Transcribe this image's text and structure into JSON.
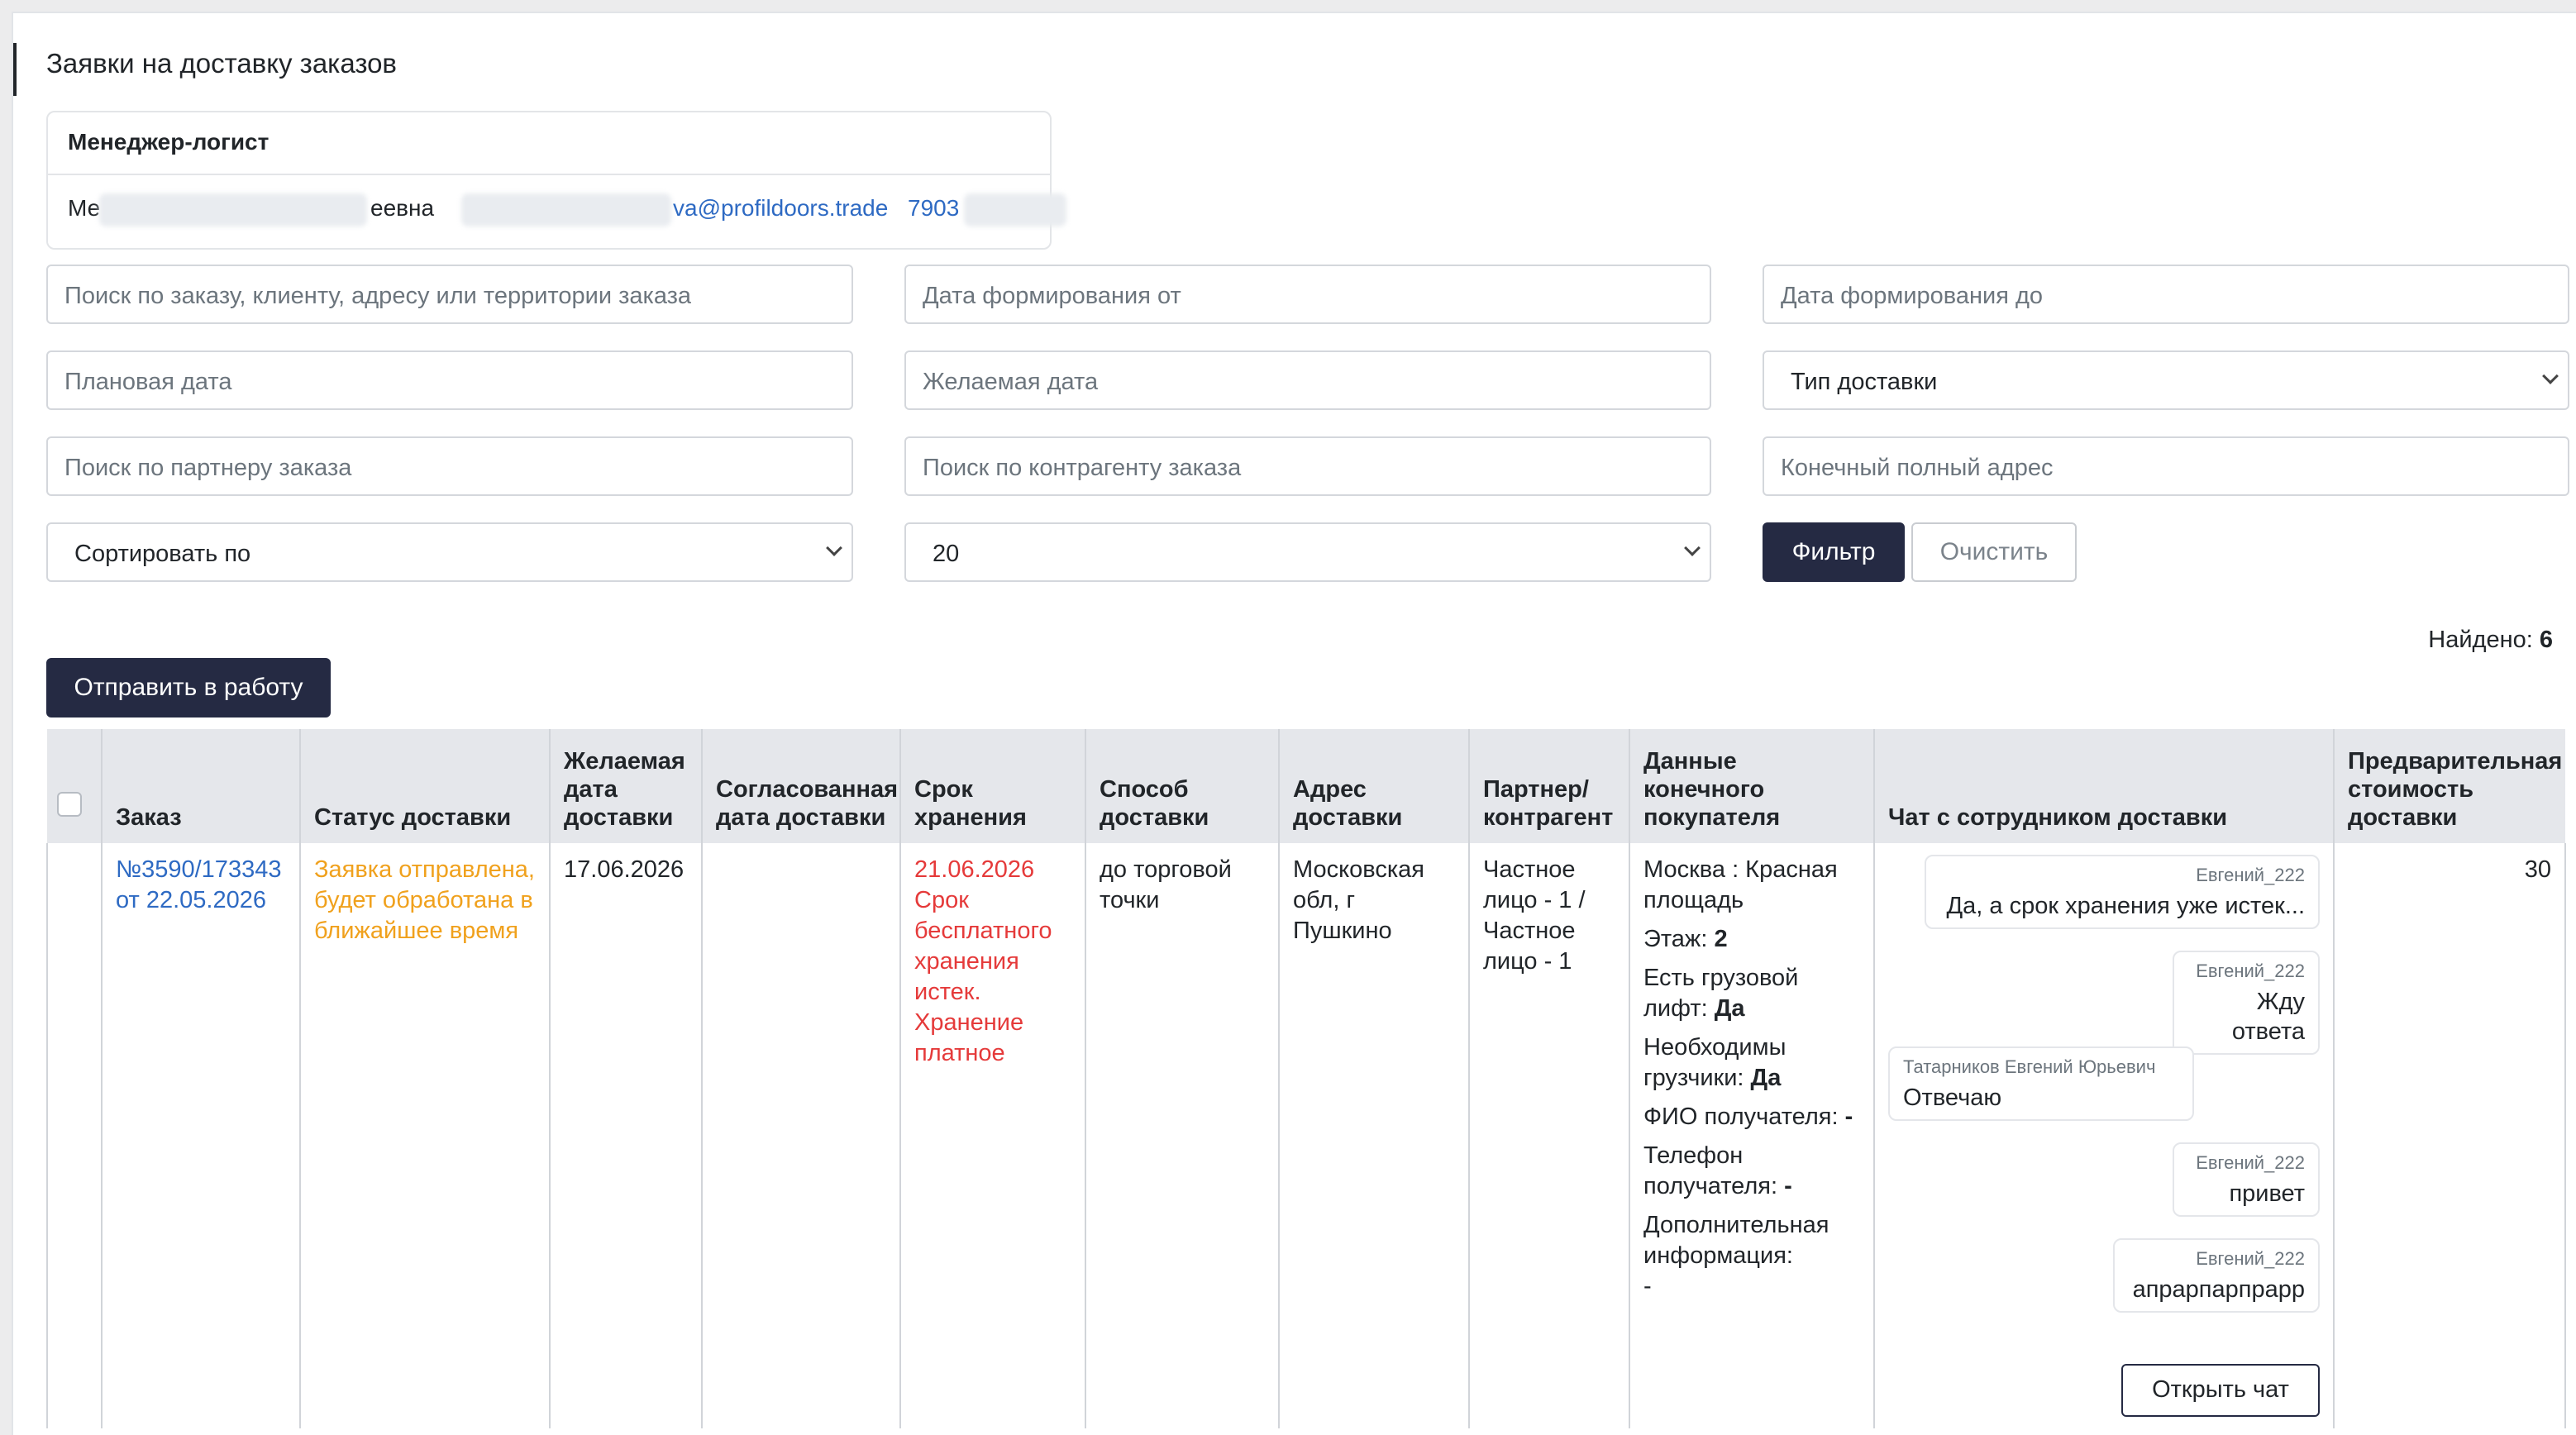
{
  "page": {
    "title": "Заявки на доставку заказов"
  },
  "manager": {
    "heading": "Менеджер-логист",
    "name_start": "Ме",
    "name_end": "еевна",
    "email_end": "va@profildoors.trade",
    "phone_start": "7903"
  },
  "filters": {
    "search_placeholder": "Поиск по заказу, клиенту, адресу или территории заказа",
    "date_from_placeholder": "Дата формирования от",
    "date_to_placeholder": "Дата формирования до",
    "planned_date_placeholder": "Плановая дата",
    "desired_date_placeholder": "Желаемая дата",
    "delivery_type_label": "Тип доставки",
    "partner_placeholder": "Поиск по партнеру заказа",
    "counterparty_placeholder": "Поиск по контрагенту заказа",
    "final_address_placeholder": "Конечный полный адрес",
    "sort_label": "Сортировать по",
    "page_size_value": "20",
    "filter_button": "Фильтр",
    "clear_button": "Очистить"
  },
  "results": {
    "found_label": "Найдено:",
    "found_count": "6"
  },
  "actions": {
    "send_to_work": "Отправить в работу"
  },
  "table": {
    "headers": {
      "order": "Заказ",
      "status": "Статус доставки",
      "desired_date": "Желаемая дата доставки",
      "agreed_date": "Согласованная дата доставки",
      "storage": "Срок хранения",
      "method": "Способ доставки",
      "address": "Адрес доставки",
      "partner": "Партнер/ контрагент",
      "buyer": "Данные конечного покупателя",
      "chat": "Чат с сотрудником доставки",
      "cost": "Предварительная стоимость доставки"
    },
    "row": {
      "order_link": "№3590/173343 от 22.05.2026",
      "status": "Заявка отправлена, будет обработана в ближайшее время",
      "desired_date": "17.06.2026",
      "agreed_date": "",
      "storage_date": "21.06.2026",
      "storage_note": "Срок бесплатного хранения истек. Хранение платное",
      "method": "до торговой точки",
      "address": "Московская обл, г Пушкино",
      "partner": "Частное лицо - 1 / Частное лицо - 1",
      "buyer": {
        "location": "Москва : Красная площадь",
        "floor_label": "Этаж:",
        "floor_value": "2",
        "lift_label": "Есть грузовой лифт:",
        "lift_value": "Да",
        "movers_label": "Необходимы грузчики:",
        "movers_value": "Да",
        "fio_label": "ФИО получателя:",
        "fio_value": "-",
        "phone_label": "Телефон получателя:",
        "phone_value": "-",
        "info_label": "Дополнительная информация:",
        "info_value": "-"
      },
      "chat": {
        "messages": [
          {
            "author": "Евгений_222",
            "text": "Да, а срок хранения уже истек..."
          },
          {
            "author": "Евгений_222",
            "text": "Жду ответа"
          },
          {
            "author": "Татарников Евгений Юрьевич",
            "text": "Отвечаю"
          },
          {
            "author": "Евгений_222",
            "text": "привет"
          },
          {
            "author": "Евгений_222",
            "text": "апрарпарпрарр"
          }
        ],
        "open_button": "Открыть чат"
      },
      "cost": "30"
    }
  }
}
